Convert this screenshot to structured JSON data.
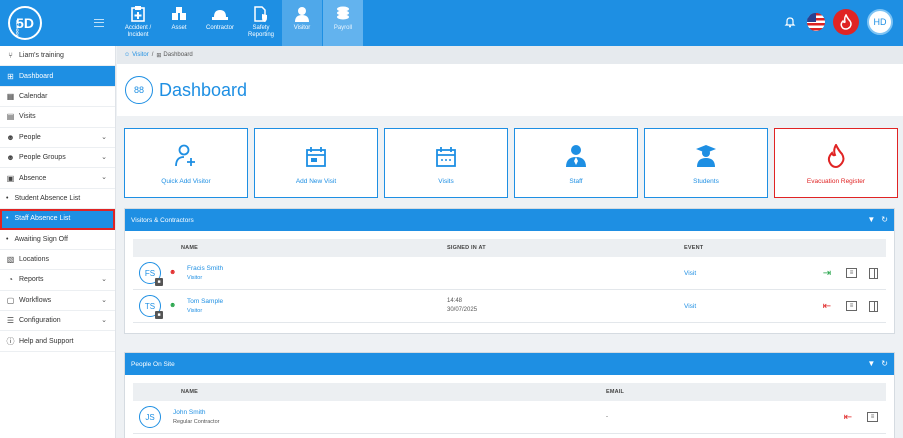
{
  "brand": {
    "logo_text": "5D",
    "logo_small": "SCHOOL"
  },
  "modules": [
    {
      "label": "Accident / Incident",
      "icon": "accident-icon"
    },
    {
      "label": "Asset",
      "icon": "asset-icon"
    },
    {
      "label": "Contractor",
      "icon": "hardhat-icon"
    },
    {
      "label": "Safety Reporting",
      "icon": "safety-icon"
    },
    {
      "label": "Visitor",
      "icon": "visitor-icon"
    },
    {
      "label": "Payroll",
      "icon": "payroll-icon"
    }
  ],
  "user": {
    "initials": "HD"
  },
  "sidebar": {
    "items": [
      {
        "label": "Liam's training",
        "icon": "branch-icon"
      },
      {
        "label": "Dashboard",
        "icon": "dashboard-icon"
      },
      {
        "label": "Calendar",
        "icon": "calendar-icon"
      },
      {
        "label": "Visits",
        "icon": "visits-icon"
      },
      {
        "label": "People",
        "icon": "people-icon"
      },
      {
        "label": "People Groups",
        "icon": "people-groups-icon"
      },
      {
        "label": "Absence",
        "icon": "absence-icon"
      },
      {
        "label": "Student Absence List"
      },
      {
        "label": "Staff Absence List"
      },
      {
        "label": "Awaiting Sign Off"
      },
      {
        "label": "Locations",
        "icon": "locations-icon"
      },
      {
        "label": "Reports",
        "icon": "reports-icon"
      },
      {
        "label": "Workflows",
        "icon": "workflows-icon"
      },
      {
        "label": "Configuration",
        "icon": "configuration-icon"
      },
      {
        "label": "Help and Support",
        "icon": "help-icon"
      }
    ]
  },
  "breadcrumb": {
    "root": "Visitor",
    "sep": "/",
    "current": "Dashboard"
  },
  "page": {
    "title": "Dashboard",
    "icon_text": "88"
  },
  "tiles": [
    {
      "label": "Quick Add Visitor"
    },
    {
      "label": "Add New Visit"
    },
    {
      "label": "Visits"
    },
    {
      "label": "Staff"
    },
    {
      "label": "Students"
    },
    {
      "label": "Evacuation Register"
    }
  ],
  "visitors_panel": {
    "title": "Visitors & Contractors",
    "columns": [
      "NAME",
      "SIGNED IN AT",
      "EVENT"
    ],
    "rows": [
      {
        "initials": "FS",
        "name": "Fracis Smith",
        "type": "Visitor",
        "signed_time": "",
        "signed_date": "",
        "event": "Visit"
      },
      {
        "initials": "TS",
        "name": "Tom Sample",
        "type": "Visitor",
        "signed_time": "14:48",
        "signed_date": "30/07/2025",
        "event": "Visit"
      }
    ]
  },
  "onsite_panel": {
    "title": "People On Site",
    "columns": [
      "NAME",
      "EMAIL"
    ],
    "rows": [
      {
        "initials": "JS",
        "name": "John Smith",
        "type": "Regular Contractor",
        "email": "-"
      }
    ]
  },
  "colors": {
    "primary": "#1e8fe3",
    "danger": "#e02424",
    "success": "#22a347"
  }
}
